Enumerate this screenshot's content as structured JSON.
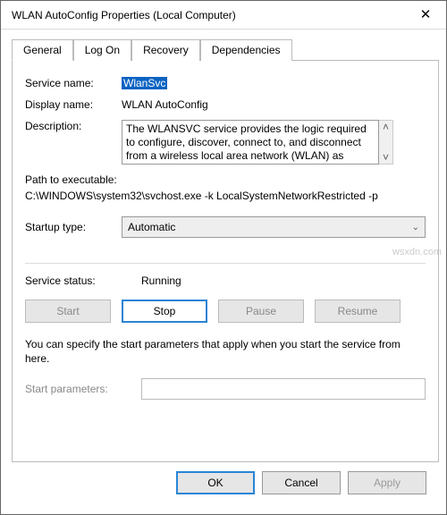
{
  "title": "WLAN AutoConfig Properties (Local Computer)",
  "tabs": [
    "General",
    "Log On",
    "Recovery",
    "Dependencies"
  ],
  "labels": {
    "service_name": "Service name:",
    "display_name": "Display name:",
    "description": "Description:",
    "path": "Path to executable:",
    "startup_type": "Startup type:",
    "service_status": "Service status:",
    "start_params": "Start parameters:"
  },
  "values": {
    "service_name": "WlanSvc",
    "display_name": "WLAN AutoConfig",
    "description": "The WLANSVC service provides the logic required to configure, discover, connect to, and disconnect from a wireless local area network (WLAN) as",
    "path": "C:\\WINDOWS\\system32\\svchost.exe -k LocalSystemNetworkRestricted -p",
    "startup_type": "Automatic",
    "service_status": "Running",
    "start_params": ""
  },
  "buttons": {
    "start": "Start",
    "stop": "Stop",
    "pause": "Pause",
    "resume": "Resume",
    "ok": "OK",
    "cancel": "Cancel",
    "apply": "Apply"
  },
  "note": "You can specify the start parameters that apply when you start the service from here.",
  "watermark": "wsxdn.com"
}
